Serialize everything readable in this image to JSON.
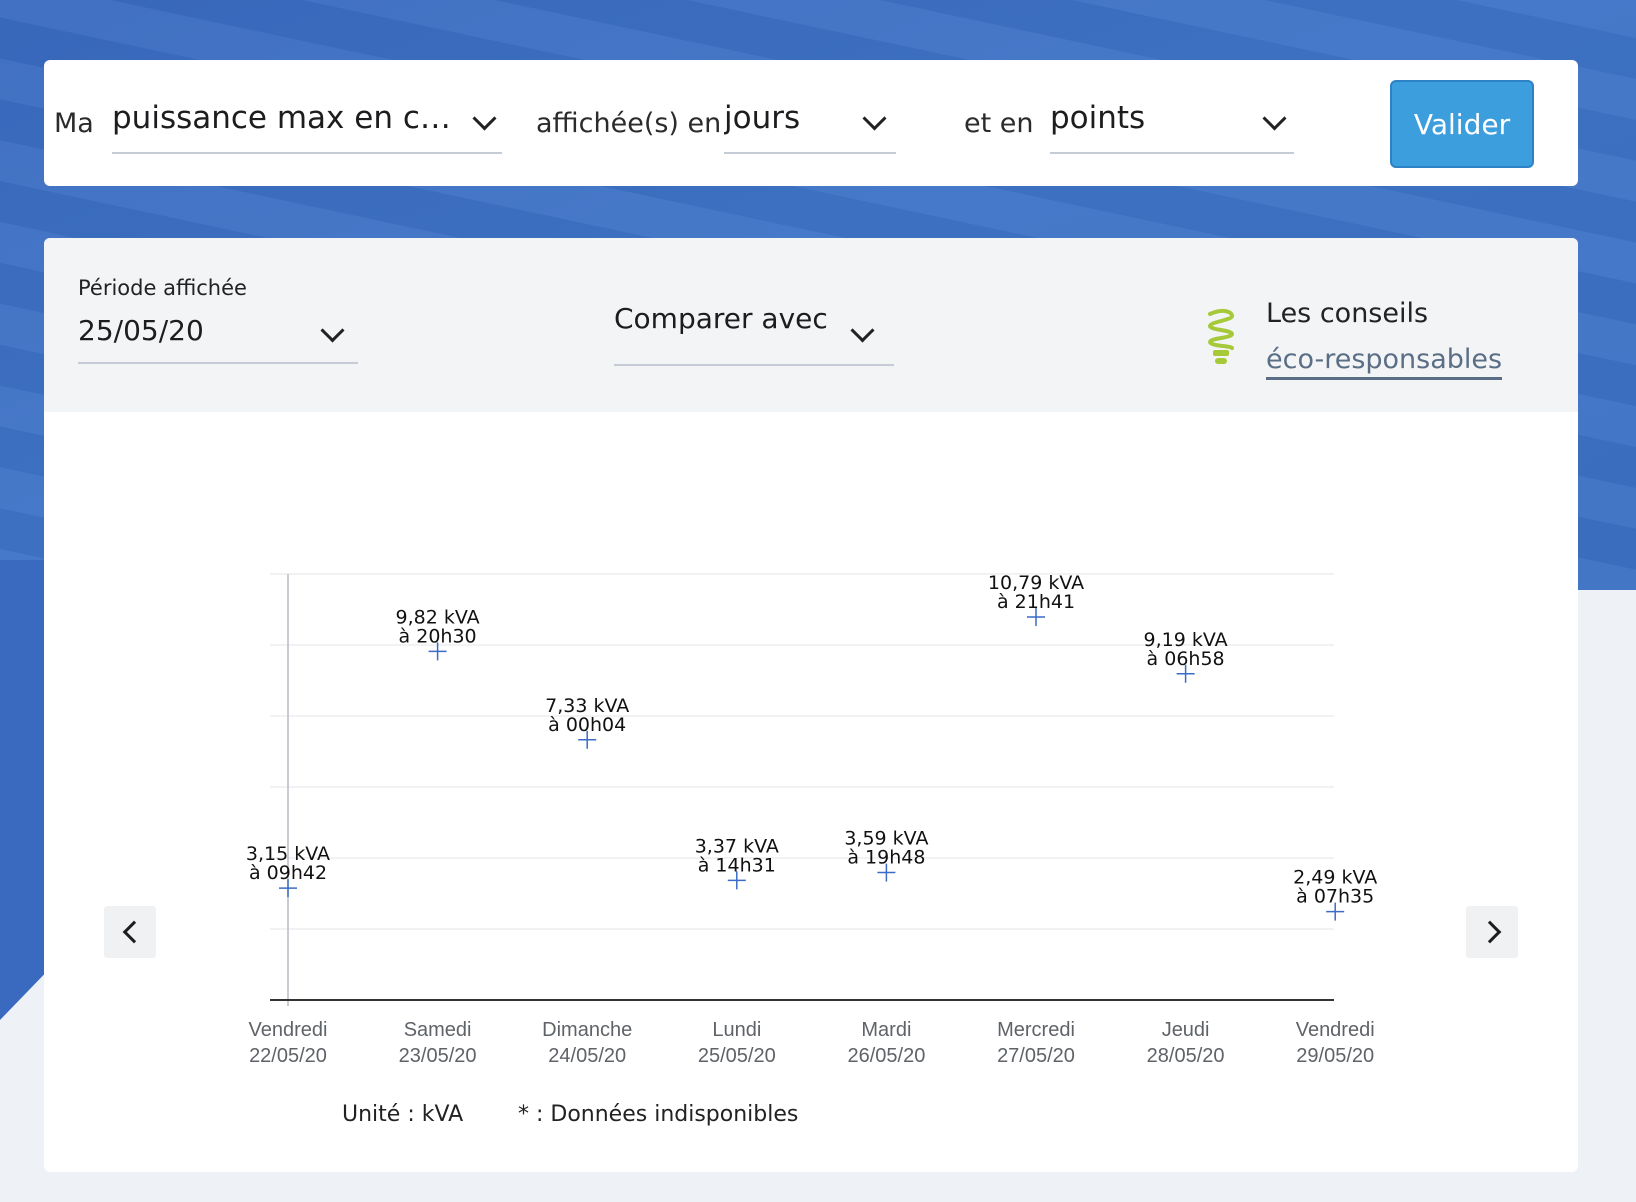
{
  "selector": {
    "prefix": "Ma",
    "measure": "puissance max en conso…",
    "shown_in_label": "affichée(s) en",
    "granularity": "jours",
    "and_in_label": "et en",
    "display_mode": "points",
    "validate_label": "Valider"
  },
  "filters": {
    "period_label": "Période affichée",
    "period_value": "25/05/20",
    "compare_label": "Comparer avec"
  },
  "eco": {
    "title": "Les conseils",
    "link": "éco-responsables",
    "icon": "bulb-icon",
    "icon_color": "#a6c93a"
  },
  "nav": {
    "prev_icon": "chevron-left-icon",
    "next_icon": "chevron-right-icon"
  },
  "legend": {
    "unit": "Unité : kVA",
    "missing": "* : Données indisponibles"
  },
  "chart_data": {
    "type": "scatter",
    "categories": [
      {
        "day": "Vendredi",
        "date": "22/05/20"
      },
      {
        "day": "Samedi",
        "date": "23/05/20"
      },
      {
        "day": "Dimanche",
        "date": "24/05/20"
      },
      {
        "day": "Lundi",
        "date": "25/05/20"
      },
      {
        "day": "Mardi",
        "date": "26/05/20"
      },
      {
        "day": "Mercredi",
        "date": "27/05/20"
      },
      {
        "day": "Jeudi",
        "date": "28/05/20"
      },
      {
        "day": "Vendredi",
        "date": "29/05/20"
      }
    ],
    "values": [
      3.15,
      9.82,
      7.33,
      3.37,
      3.59,
      10.79,
      9.19,
      2.49
    ],
    "value_labels": [
      "3,15 kVA",
      "9,82 kVA",
      "7,33 kVA",
      "3,37 kVA",
      "3,59 kVA",
      "10,79 kVA",
      "9,19 kVA",
      "2,49 kVA"
    ],
    "time_labels": [
      "à 09h42",
      "à 20h30",
      "à 00h04",
      "à 14h31",
      "à 19h48",
      "à 21h41",
      "à 06h58",
      "à 07h35"
    ],
    "ylim": [
      0,
      12
    ],
    "grid": true,
    "marker_color": "#3b6bc7"
  }
}
